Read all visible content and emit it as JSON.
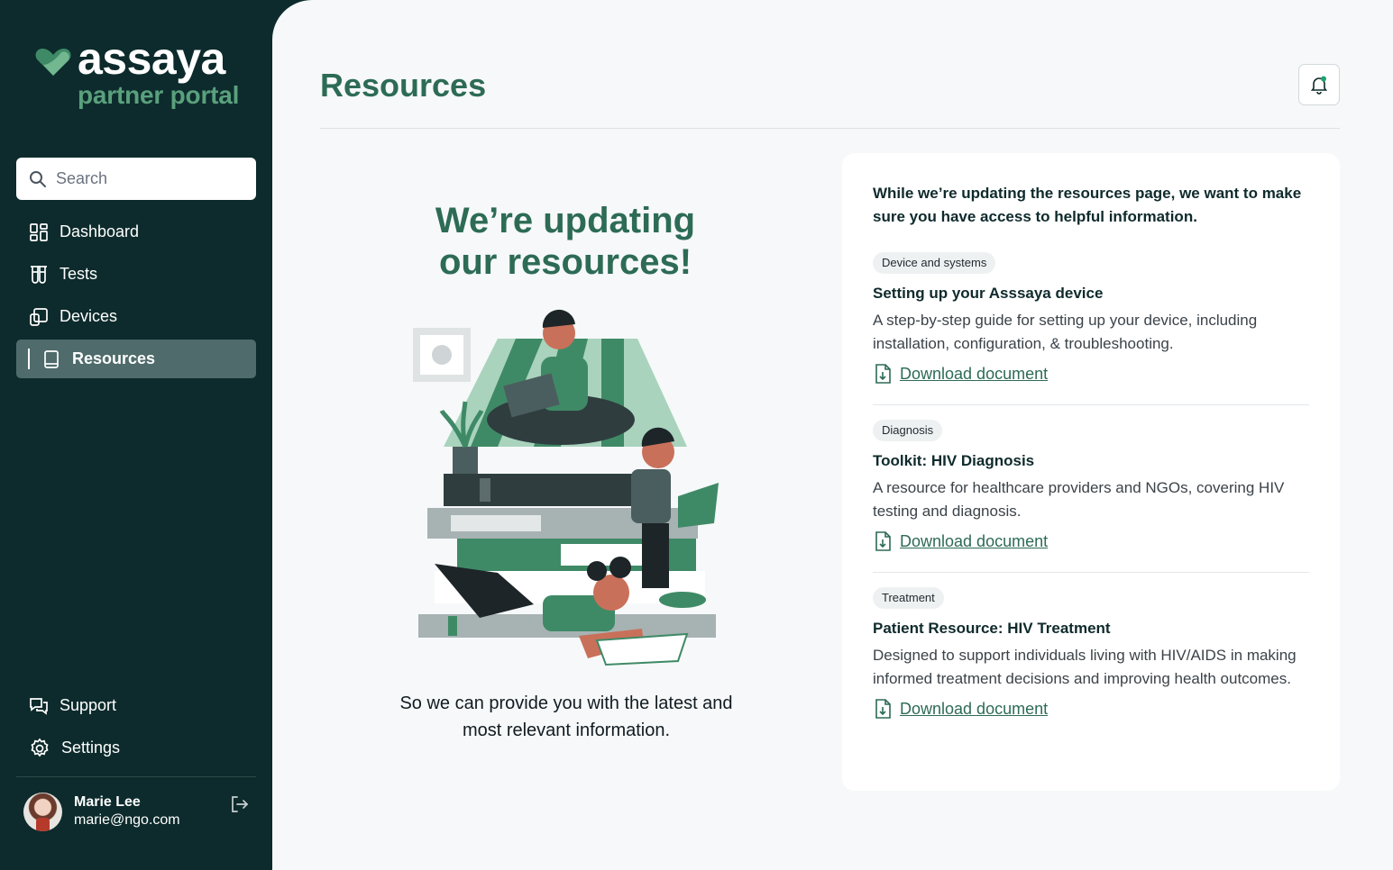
{
  "brand": {
    "name": "assaya",
    "subtitle": "partner portal",
    "accent": "#2d6b55",
    "sidebar_bg": "#0d2b2c"
  },
  "search": {
    "placeholder": "Search"
  },
  "nav": {
    "items": [
      {
        "label": "Dashboard",
        "icon": "dashboard-icon"
      },
      {
        "label": "Tests",
        "icon": "test-tubes-icon"
      },
      {
        "label": "Devices",
        "icon": "devices-icon"
      },
      {
        "label": "Resources",
        "icon": "book-icon",
        "active": true
      }
    ],
    "bottom": [
      {
        "label": "Support",
        "icon": "chat-icon"
      },
      {
        "label": "Settings",
        "icon": "gear-icon"
      }
    ]
  },
  "user": {
    "name": "Marie Lee",
    "email": "marie@ngo.com"
  },
  "page": {
    "title": "Resources"
  },
  "hero": {
    "title": "We’re updating our resources!",
    "subtitle": "So we can provide you with the latest and most relevant information."
  },
  "card": {
    "intro": "While we’re updating the resources page, we want to make sure you have access to helpful information.",
    "resources": [
      {
        "tag": "Device and systems",
        "title": "Setting up your Asssaya device",
        "description": "A step-by-step guide for setting up your device, including installation, configuration, & troubleshooting.",
        "link": "Download document"
      },
      {
        "tag": "Diagnosis",
        "title": "Toolkit: HIV Diagnosis",
        "description": "A resource for healthcare providers and NGOs, covering HIV testing and diagnosis.",
        "link": "Download document"
      },
      {
        "tag": "Treatment",
        "title": "Patient Resource: HIV Treatment",
        "description": "Designed to support individuals living with HIV/AIDS in making informed treatment decisions and improving health outcomes.",
        "link": "Download document"
      }
    ]
  }
}
